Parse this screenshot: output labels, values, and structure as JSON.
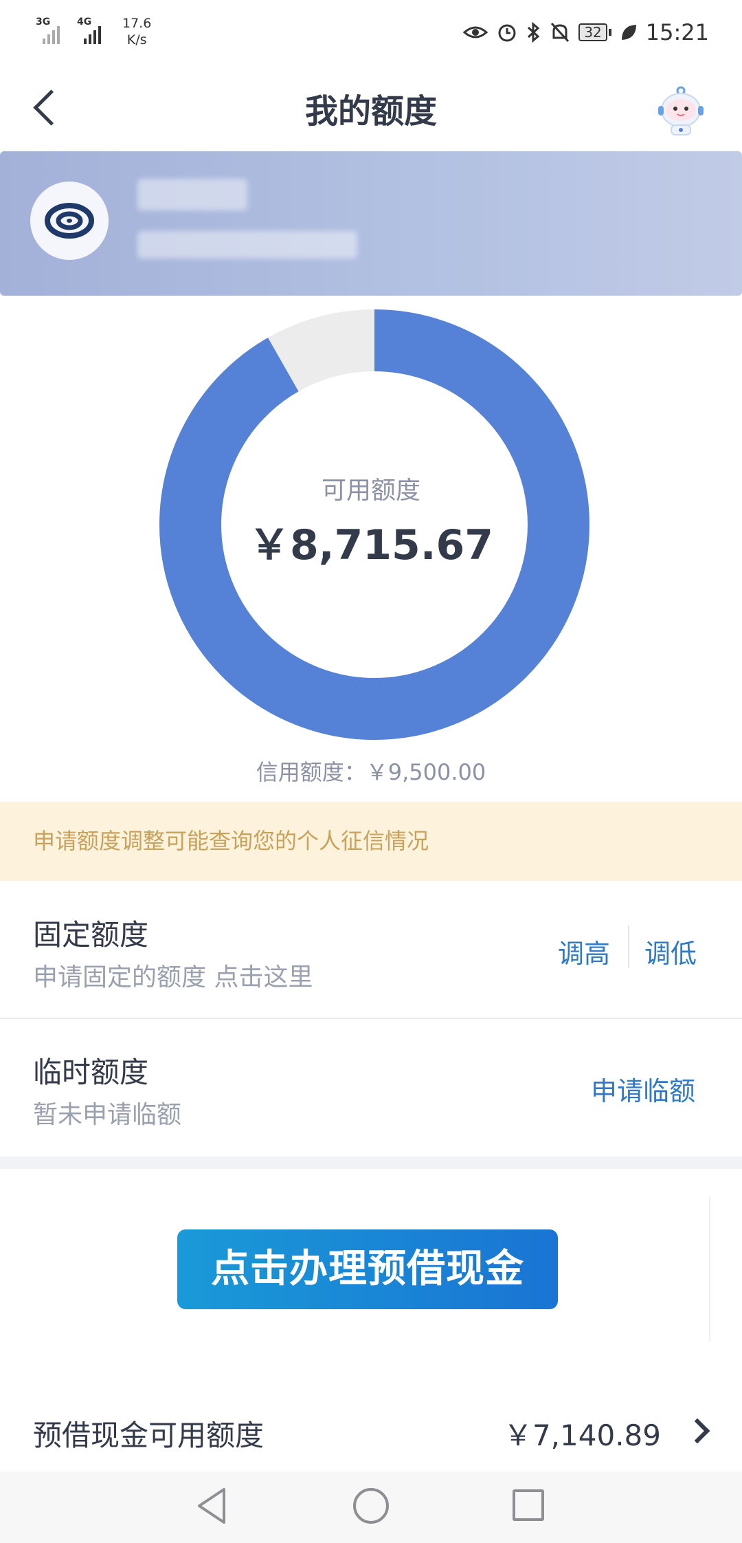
{
  "status_bar": {
    "network_1": "3G",
    "network_2": "4G",
    "speed_value": "17.6",
    "speed_unit": "K/s",
    "battery": "32",
    "time": "15:21"
  },
  "header": {
    "title": "我的额度"
  },
  "quota": {
    "available_label": "可用额度",
    "available_value": "￥8,715.67",
    "credit_line": "信用额度：￥9,500.00",
    "available_amount": 8715.67,
    "credit_amount": 9500.0,
    "colors": {
      "available": "#5582d6",
      "used": "#ececec"
    }
  },
  "notice": {
    "text": "申请额度调整可能查询您的个人征信情况"
  },
  "fixed_quota": {
    "title": "固定额度",
    "subtitle": "申请固定的额度 点击这里",
    "raise_label": "调高",
    "lower_label": "调低"
  },
  "temp_quota": {
    "title": "临时额度",
    "subtitle": "暂未申请临额",
    "apply_label": "申请临额"
  },
  "promo": {
    "label": "点击办理预借现金"
  },
  "cash_advance": {
    "label": "预借现金可用额度",
    "value": "￥7,140.89"
  }
}
